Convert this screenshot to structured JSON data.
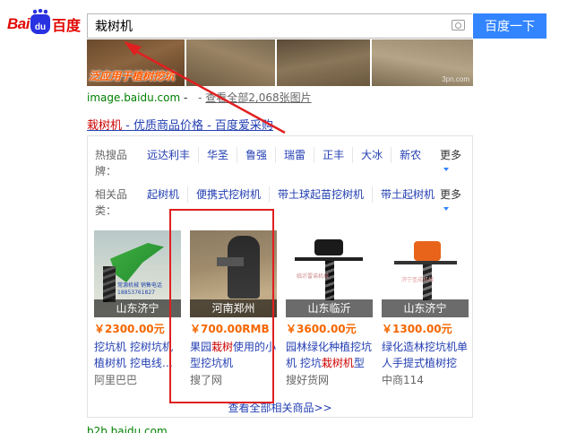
{
  "logo": {
    "bai": "Bai",
    "du": "du",
    "cn": "百度"
  },
  "search": {
    "query": "栽树机",
    "button": "百度一下"
  },
  "image_strip": {
    "caption": "泛应用于植树挖坑",
    "watermark": "3pn.com"
  },
  "image_source": {
    "source": "image.baidu.com",
    "sep": " - ",
    "more": "查看全部2,068张图片"
  },
  "result": {
    "title_hl": "栽树机",
    "title_rest": " - 优质商品价格 - 百度爱采购"
  },
  "hot_brands": {
    "label": "热搜品牌：",
    "items": [
      "远达利丰",
      "华圣",
      "鲁强",
      "瑞雷",
      "正丰",
      "大冰",
      "新农"
    ],
    "more": "更多"
  },
  "related": {
    "label": "相关品类：",
    "items": [
      "起树机",
      "便携式挖树机",
      "带土球起苗挖树机",
      "带土起树机"
    ],
    "more": "更多"
  },
  "products": [
    {
      "location": "山东济宁",
      "price": "￥2300.00元",
      "name_hl": "",
      "name": "挖坑机 挖树坑机 植树机 挖电线…",
      "seller": "阿里巴巴",
      "watermark": "常源机械 销售电话 18853761827"
    },
    {
      "location": "河南郑州",
      "price": "￥700.00RMB",
      "name_pre": "果园",
      "name_hl": "栽树",
      "name_post": "使用的小型挖坑机",
      "seller": "搜了网"
    },
    {
      "location": "山东临沂",
      "price": "￥3600.00元",
      "name_pre": "园林绿化种植挖坑机 挖坑",
      "name_hl": "栽树机",
      "name_post": "型",
      "seller": "搜好货网",
      "watermark": "临沂雷诺机械"
    },
    {
      "location": "山东济宁",
      "price": "￥1300.00元",
      "name": "绿化造林挖坑机单人手提式植树挖",
      "seller": "中商114",
      "watermark": "济宁圣成机械"
    }
  ],
  "see_all": "查看全部相关商品>>",
  "b2b": "b2b.baidu.com",
  "colors": {
    "accent": "#3385ff",
    "link": "#2440b3",
    "price": "#f56600",
    "annotation": "#e02020"
  }
}
